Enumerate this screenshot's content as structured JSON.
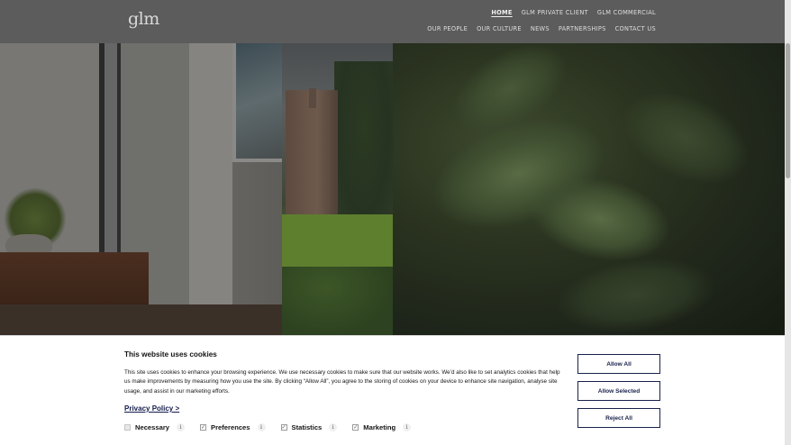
{
  "header": {
    "logo": "glm",
    "nav_primary": [
      {
        "label": "HOME",
        "active": true
      },
      {
        "label": "GLM PRIVATE CLIENT",
        "active": false
      },
      {
        "label": "GLM COMMERCIAL",
        "active": false
      }
    ],
    "nav_secondary": [
      {
        "label": "OUR PEOPLE"
      },
      {
        "label": "OUR CULTURE"
      },
      {
        "label": "NEWS"
      },
      {
        "label": "PARTNERSHIPS"
      },
      {
        "label": "CONTACT US"
      }
    ]
  },
  "cookie_banner": {
    "title": "This website uses cookies",
    "body": "This site uses cookies to enhance your browsing experience. We use necessary cookies to make sure that our website works. We’d also like to set analytics cookies that help us make improvements by measuring how you use the site. By clicking “Allow All”, you agree to the storing of cookies on your device to enhance site navigation, analyse site usage, and assist in our marketing efforts.",
    "privacy_link": "Privacy Policy >",
    "categories": [
      {
        "label": "Necessary",
        "checked": true,
        "disabled": true
      },
      {
        "label": "Preferences",
        "checked": true,
        "disabled": false
      },
      {
        "label": "Statistics",
        "checked": true,
        "disabled": false
      },
      {
        "label": "Marketing",
        "checked": true,
        "disabled": false
      }
    ],
    "info_glyph": "i",
    "buttons": {
      "allow_all": "Allow All",
      "allow_selected": "Allow Selected",
      "reject_all": "Reject All"
    }
  },
  "colors": {
    "header_bg": "#5c5c5c",
    "button_border": "#19214b",
    "link": "#141b4d"
  }
}
